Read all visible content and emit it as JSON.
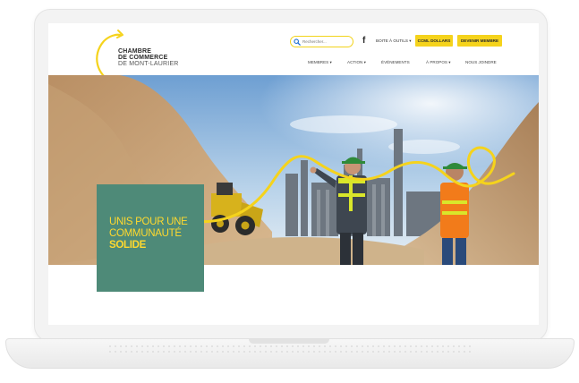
{
  "header": {
    "logo": {
      "line1": "CHAMBRE",
      "line2": "DE COMMERCE",
      "line3": "DE MONT-LAURIER"
    },
    "search": {
      "placeholder": "Rechercher..."
    },
    "social": {
      "facebook": "f"
    },
    "tools_link": "BOITE À OUTILS ▾",
    "dollars_button": "CCML DOLLARS",
    "member_button": "DEVENIR MEMBRE"
  },
  "nav": {
    "items": [
      {
        "label": "MEMBRES ▾"
      },
      {
        "label": "ACTION ▾"
      },
      {
        "label": "ÉVÉNEMENTS"
      },
      {
        "label": "À PROPOS ▾"
      },
      {
        "label": "NOUS JOINDRE"
      }
    ]
  },
  "hero": {
    "line1": "UNIS POUR UNE",
    "line2": "COMMUNAUTÉ",
    "line3": "SOLIDE"
  },
  "colors": {
    "accent_yellow": "#f5d31c",
    "hero_box_green": "#4e8a78",
    "hero_text_yellow": "#ffd92e"
  },
  "icons": {
    "search": "search-icon",
    "facebook": "facebook-icon",
    "logo": "swoosh-logo-icon"
  }
}
